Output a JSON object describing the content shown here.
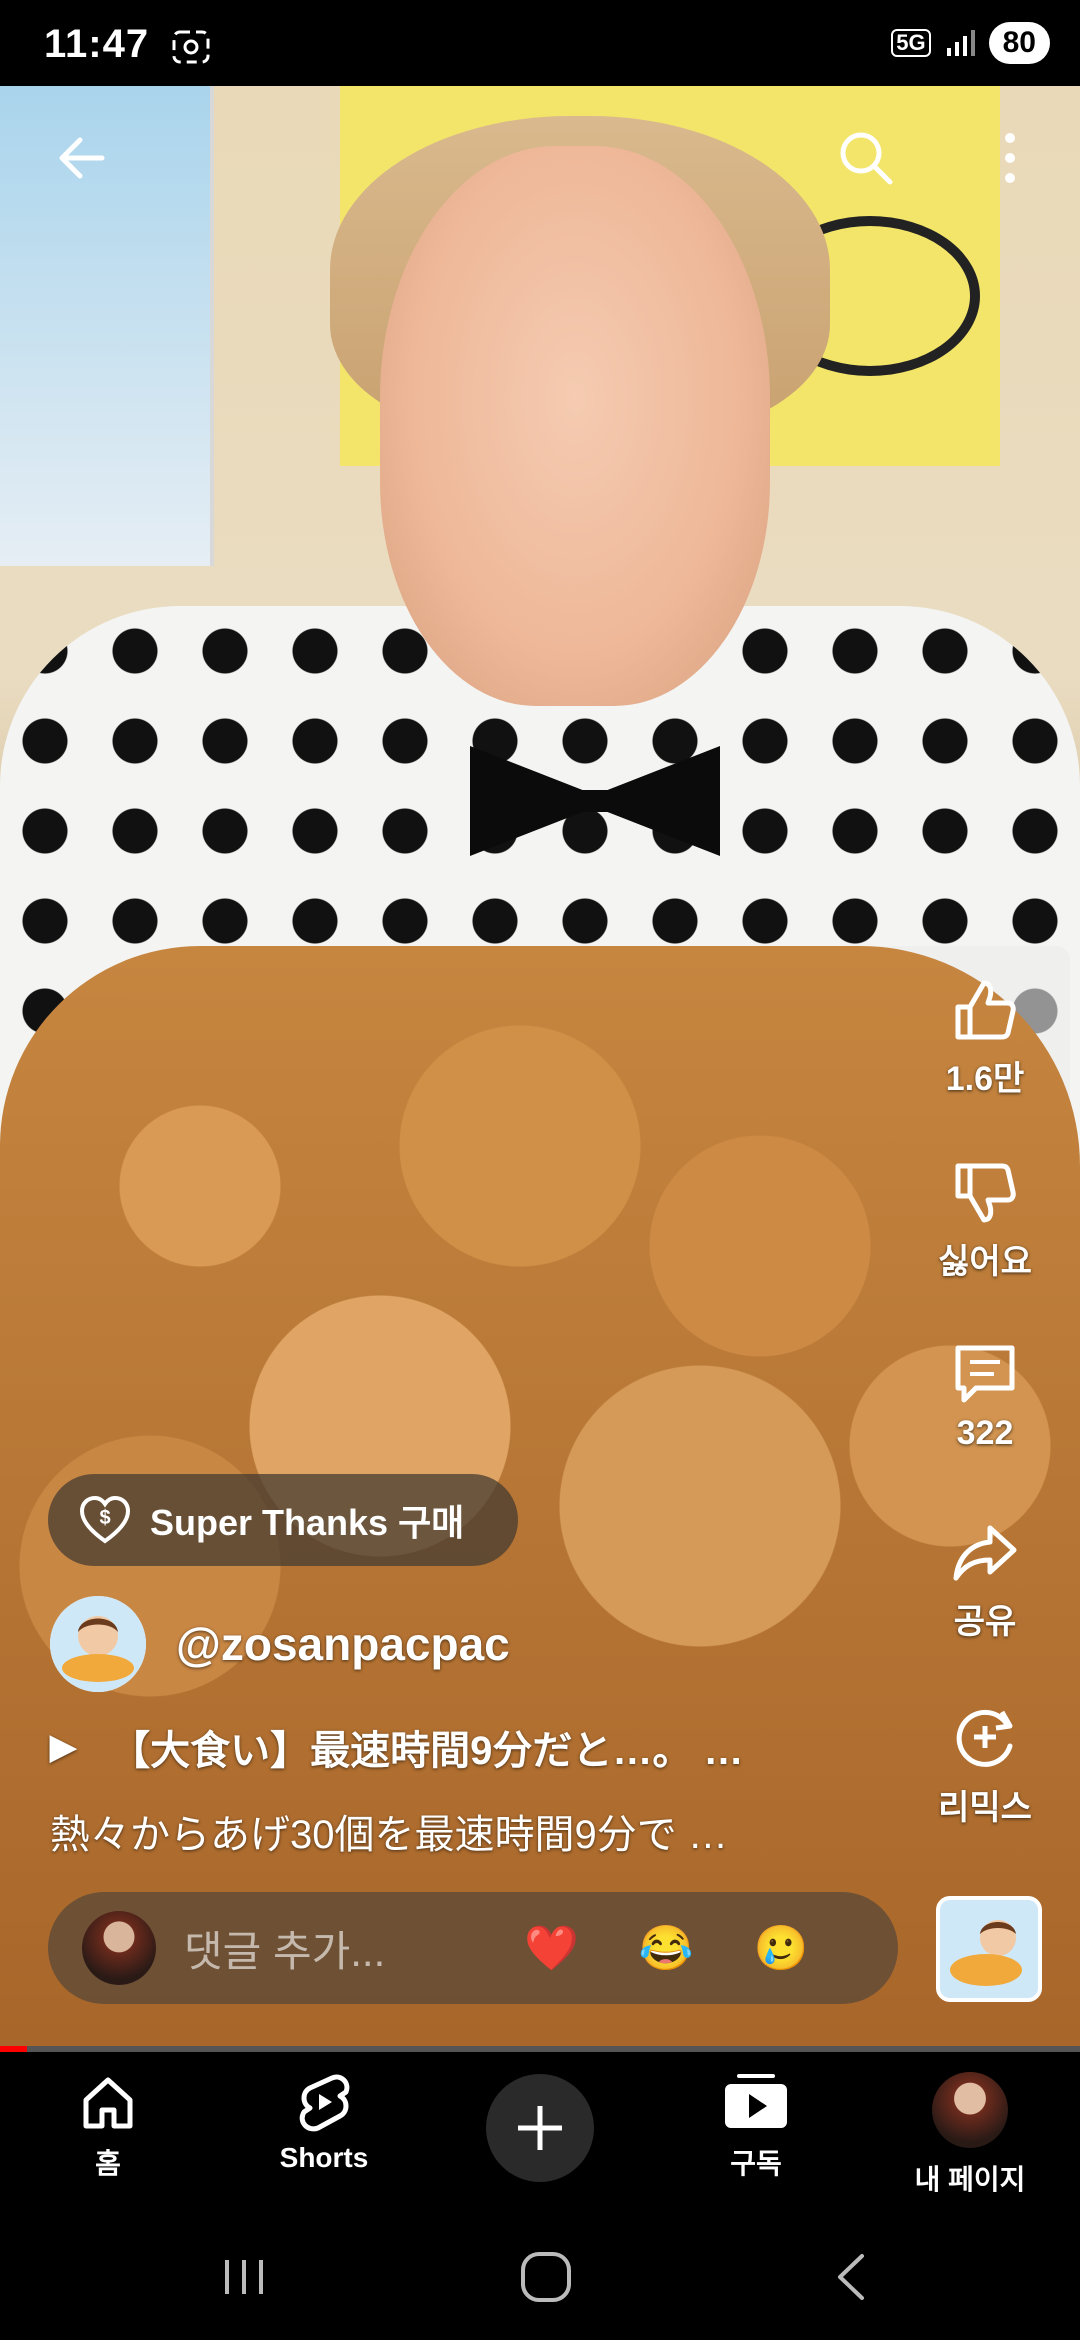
{
  "status_bar": {
    "time": "11:47",
    "network": "5G",
    "battery": "80"
  },
  "actions": {
    "like_count": "1.6만",
    "dislike_label": "싫어요",
    "comment_count": "322",
    "share_label": "공유",
    "remix_label": "리믹스"
  },
  "super_thanks": {
    "label": "Super Thanks 구매"
  },
  "channel": {
    "handle": "@zosanpacpac"
  },
  "video": {
    "title": "【大食い】最速時間9分だと…。 …",
    "description": "熱々からあげ30個を最速時間9分で …",
    "progress_fraction": 0.025
  },
  "comment": {
    "placeholder": "댓글 추가...",
    "quick_emojis": [
      "❤️",
      "😂",
      "🥲"
    ]
  },
  "bottom_nav": {
    "home": "홈",
    "shorts": "Shorts",
    "subscriptions": "구독",
    "my_page": "내 페이지"
  },
  "colors": {
    "accent": "#ff0000",
    "nav_bg": "#000000"
  }
}
